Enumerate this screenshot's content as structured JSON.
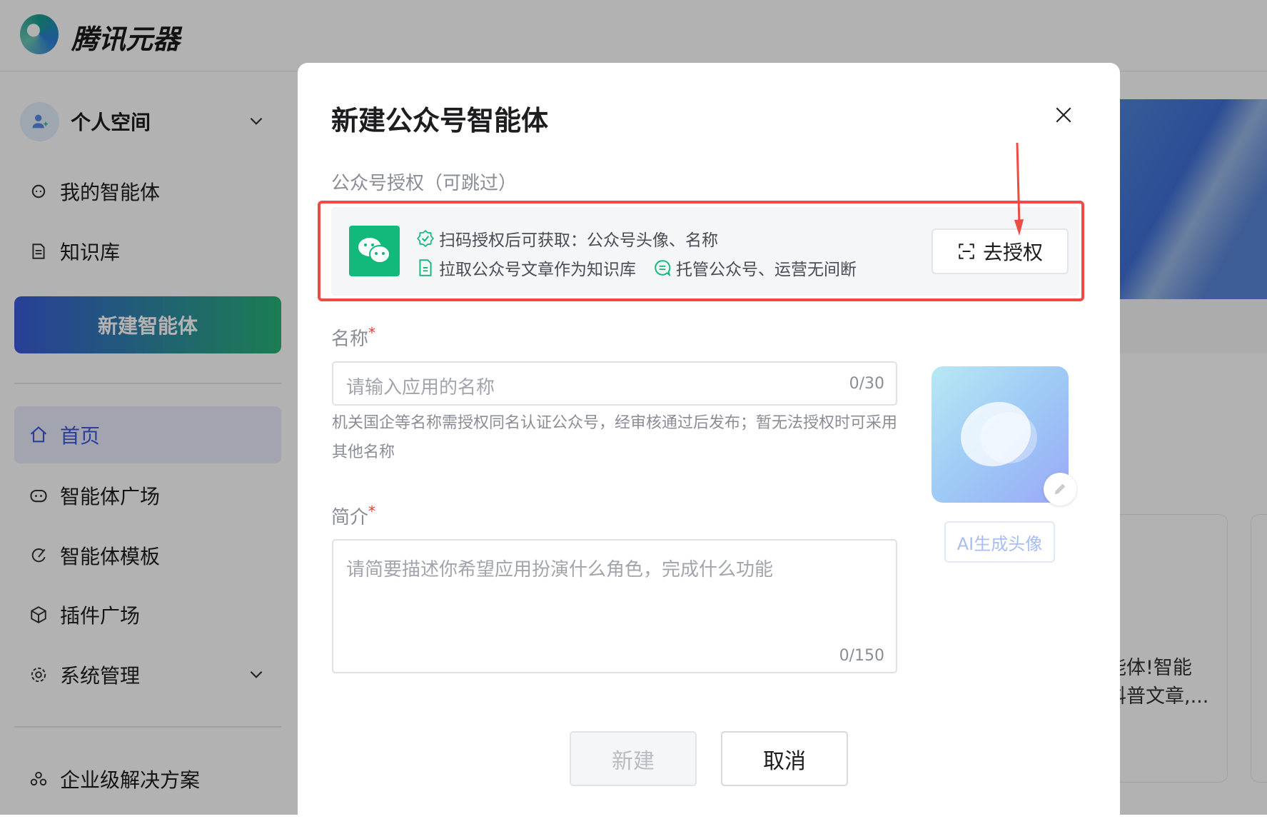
{
  "app": {
    "name": "腾讯元器"
  },
  "sidebar": {
    "space": "个人空间",
    "items_top": [
      {
        "label": "我的智能体"
      },
      {
        "label": "知识库"
      }
    ],
    "new_agent": "新建智能体",
    "nav": [
      {
        "label": "首页"
      },
      {
        "label": "智能体广场"
      },
      {
        "label": "智能体模板"
      },
      {
        "label": "插件广场"
      },
      {
        "label": "系统管理"
      }
    ],
    "enterprise": "企业级解决方案"
  },
  "background": {
    "card_text_1": "能体!智能",
    "card_text_2": "科普文章,..."
  },
  "modal": {
    "title": "新建公众号智能体",
    "auth_section": "公众号授权（可跳过）",
    "feature_1": "扫码授权后可获取：公众号头像、名称",
    "feature_2": "拉取公众号文章作为知识库",
    "feature_3": "托管公众号、运营无间断",
    "auth_button": "去授权",
    "name_label": "名称",
    "required": "*",
    "name_placeholder": "请输入应用的名称",
    "name_count": "0/30",
    "name_hint": "机关国企等名称需授权同名认证公众号，经审核通过后发布；暂无法授权时可采用其他名称",
    "ai_avatar_button": "AI生成头像",
    "intro_label": "简介",
    "intro_placeholder": "请简要描述你希望应用扮演什么角色，完成什么功能",
    "intro_count": "0/150",
    "create_button": "新建",
    "cancel_button": "取消"
  },
  "colors": {
    "accent": "#3f58d8",
    "wechat": "#11b97a",
    "highlight": "#ee4b44"
  }
}
